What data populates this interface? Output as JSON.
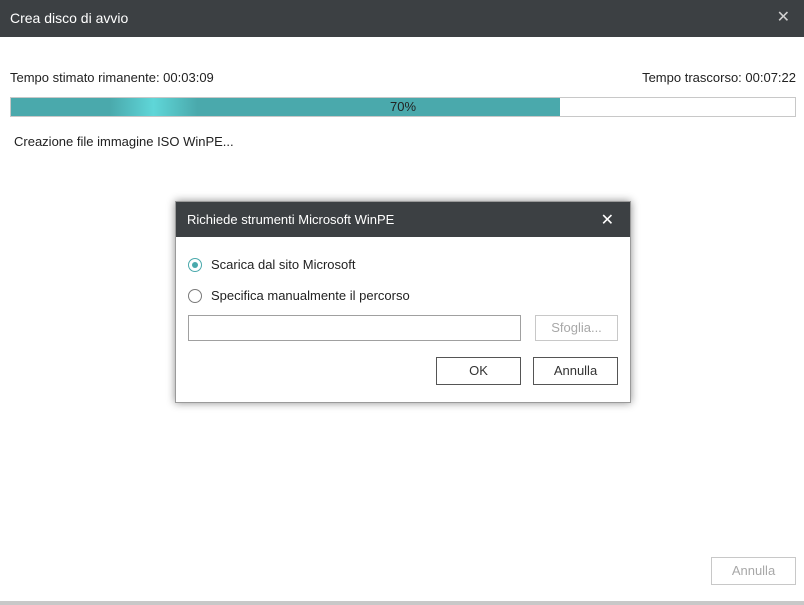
{
  "window": {
    "title": "Crea disco di avvio",
    "close_glyph": "✕"
  },
  "progress": {
    "remaining_label": "Tempo stimato rimanente: 00:03:09",
    "elapsed_label": "Tempo trascorso: 00:07:22",
    "percent_text": "70%",
    "percent": 70,
    "accent": "#4aa9ac"
  },
  "status_text": "Creazione file immagine ISO WinPE...",
  "dialog": {
    "title": "Richiede strumenti Microsoft WinPE",
    "close_glyph": "✕",
    "options": [
      {
        "label": "Scarica dal sito Microsoft",
        "selected": true
      },
      {
        "label": "Specifica manualmente il percorso",
        "selected": false
      }
    ],
    "path_value": "",
    "browse_label": "Sfoglia...",
    "ok_label": "OK",
    "cancel_label": "Annulla"
  },
  "footer": {
    "cancel_label": "Annulla"
  }
}
